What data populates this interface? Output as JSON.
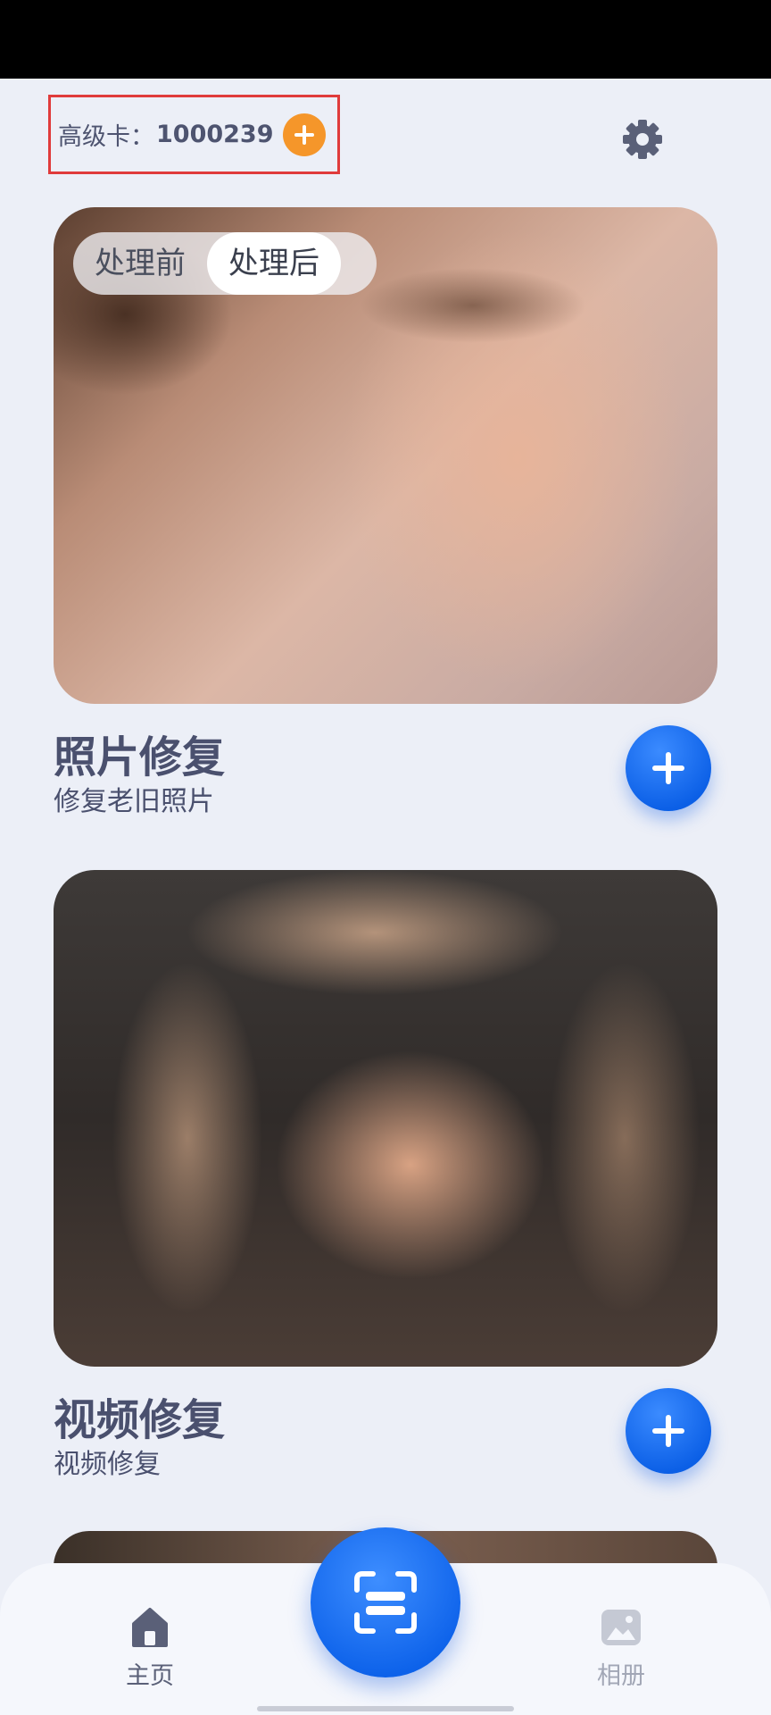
{
  "header": {
    "vip_label": "高级卡：",
    "vip_value": "1000239"
  },
  "cards": [
    {
      "toggle": {
        "before": "处理前",
        "after": "处理后",
        "selected": "处理后"
      },
      "title": "照片修复",
      "subtitle": "修复老旧照片"
    },
    {
      "title": "视频修复",
      "subtitle": "视频修复"
    }
  ],
  "nav": {
    "home_label": "主页",
    "album_label": "相册"
  },
  "colors": {
    "accent": "#1A6CF0",
    "vip_orange": "#F5962A",
    "text": "#4A506E",
    "background": "#ECEFF7"
  },
  "icons": [
    "plus-icon",
    "gear-icon",
    "home-icon",
    "scan-icon",
    "image-icon"
  ]
}
